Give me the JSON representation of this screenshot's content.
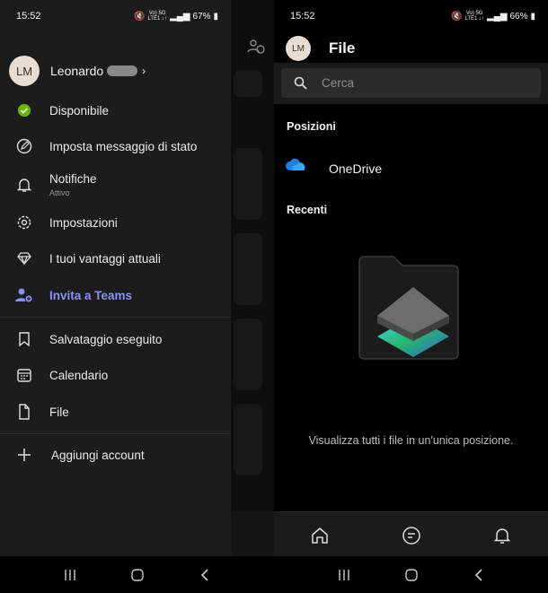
{
  "left": {
    "status": {
      "time": "15:52",
      "net": "Vo) 5G\nLTE1 ↓↑",
      "battery": "67%"
    },
    "profile": {
      "initials": "LM",
      "name": "Leonardo",
      "chevron": "›"
    },
    "menu": {
      "available": "Disponibile",
      "status_msg": "Imposta messaggio di stato",
      "notifications": "Notifiche",
      "notifications_sub": "Attivo",
      "settings": "Impostazioni",
      "perks": "I tuoi vantaggi attuali",
      "invite": "Invita a Teams",
      "saved": "Salvataggio eseguito",
      "calendar": "Calendario",
      "files": "File",
      "add_account": "Aggiungi account"
    },
    "colors": {
      "available": "#6bb700",
      "invite": "#8b8ff4"
    }
  },
  "right": {
    "status": {
      "time": "15:52",
      "net": "Vo) 5G\nLTE1 ↓↑",
      "battery": "66%"
    },
    "header": {
      "initials": "LM",
      "title": "File"
    },
    "search": {
      "placeholder": "Cerca"
    },
    "sections": {
      "locations": "Posizioni",
      "recent": "Recenti"
    },
    "onedrive_label": "OneDrive",
    "empty_text": "Visualizza tutti i file in un'unica posizione.",
    "tabs": [
      "home-icon",
      "chat-icon",
      "bell-icon"
    ]
  }
}
